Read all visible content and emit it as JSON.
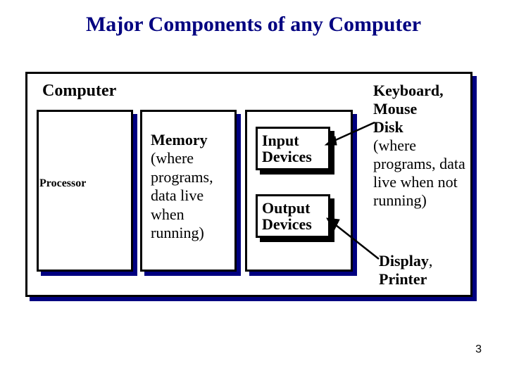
{
  "title": "Major Components of any Computer",
  "computer_label": "Computer",
  "processor": {
    "label": "Processor"
  },
  "memory": {
    "heading": "Memory",
    "body": "(where programs, data live when running)"
  },
  "input_devices": {
    "line1": "Input",
    "line2": "Devices"
  },
  "output_devices": {
    "line1": "Output",
    "line2": "Devices"
  },
  "peripherals_top": {
    "line1": "Keyboard,",
    "line2": "Mouse",
    "line3": "Disk",
    "body": "(where programs, data live when not running)"
  },
  "peripherals_bottom": {
    "line1": "Display",
    "line2": "Printer"
  },
  "page_number": "3"
}
